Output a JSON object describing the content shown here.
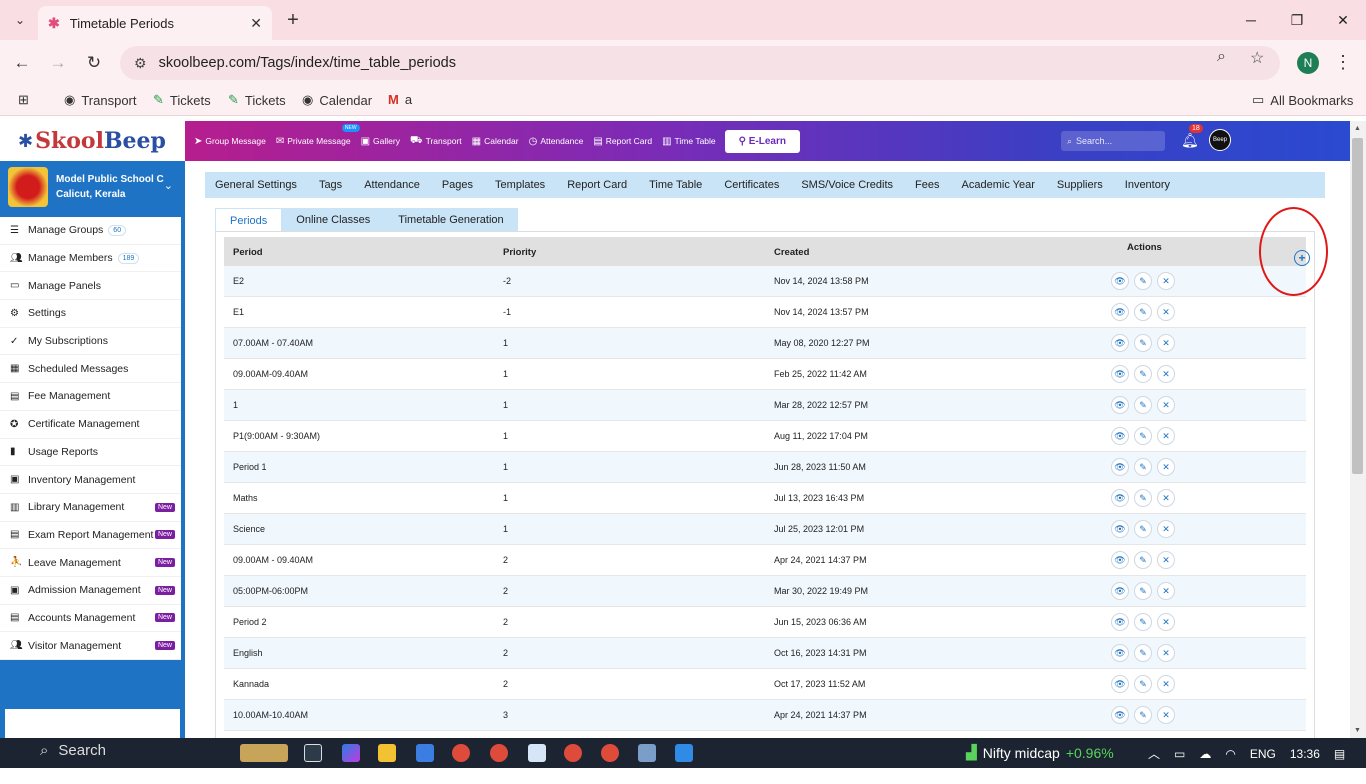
{
  "browser": {
    "tab_title": "Timetable Periods",
    "url": "skoolbeep.com/Tags/index/time_table_periods",
    "bookmarks": [
      "Transport",
      "Tickets",
      "Tickets",
      "Calendar",
      "a"
    ],
    "all_bookmarks": "All Bookmarks",
    "profile_initial": "N"
  },
  "app": {
    "logo_part1": "Skool",
    "logo_part2": "Beep",
    "topnav": [
      {
        "label": "Group Message",
        "icon": "send-icon"
      },
      {
        "label": "Private Message",
        "icon": "mail-icon",
        "badge": "NEW"
      },
      {
        "label": "Gallery",
        "icon": "image-icon"
      },
      {
        "label": "Transport",
        "icon": "bus-icon"
      },
      {
        "label": "Calendar",
        "icon": "calendar-icon"
      },
      {
        "label": "Attendance",
        "icon": "clock-icon"
      },
      {
        "label": "Report Card",
        "icon": "document-icon"
      },
      {
        "label": "Time Table",
        "icon": "timetable-icon"
      }
    ],
    "elearn": "E-Learn",
    "search_placeholder": "Search...",
    "notification_count": "18",
    "avatar_text": "Beep"
  },
  "school": {
    "name": "Model Public School C",
    "location": "Calicut, Kerala"
  },
  "sidebar": [
    {
      "label": "Manage Groups",
      "count": "60",
      "icon": "list-icon"
    },
    {
      "label": "Manage Members",
      "count": "189",
      "icon": "users-icon"
    },
    {
      "label": "Manage Panels",
      "icon": "monitor-icon"
    },
    {
      "label": "Settings",
      "icon": "gear-icon"
    },
    {
      "label": "My Subscriptions",
      "icon": "check-icon"
    },
    {
      "label": "Scheduled Messages",
      "icon": "calendar-icon"
    },
    {
      "label": "Fee Management",
      "icon": "file-icon"
    },
    {
      "label": "Certificate Management",
      "icon": "certificate-icon"
    },
    {
      "label": "Usage Reports",
      "icon": "chart-icon"
    },
    {
      "label": "Inventory Management",
      "icon": "box-icon"
    },
    {
      "label": "Library Management",
      "icon": "book-icon",
      "new": "New"
    },
    {
      "label": "Exam Report Management",
      "icon": "file-icon",
      "new": "New"
    },
    {
      "label": "Leave Management",
      "icon": "leave-icon",
      "new": "New"
    },
    {
      "label": "Admission Management",
      "icon": "admission-icon",
      "new": "New"
    },
    {
      "label": "Accounts Management",
      "icon": "file-icon",
      "new": "New"
    },
    {
      "label": "Visitor Management",
      "icon": "users-icon",
      "new": "New"
    }
  ],
  "subtabs": [
    "General Settings",
    "Tags",
    "Attendance",
    "Pages",
    "Templates",
    "Report Card",
    "Time Table",
    "Certificates",
    "SMS/Voice Credits",
    "Fees",
    "Academic Year",
    "Suppliers",
    "Inventory"
  ],
  "innertabs": [
    "Periods",
    "Online Classes",
    "Timetable Generation"
  ],
  "table": {
    "headers": [
      "Period",
      "Priority",
      "Created",
      "Actions"
    ],
    "rows": [
      [
        "E2",
        "-2",
        "Nov 14, 2024 13:58 PM"
      ],
      [
        "E1",
        "-1",
        "Nov 14, 2024 13:57 PM"
      ],
      [
        "07.00AM - 07.40AM",
        "1",
        "May 08, 2020 12:27 PM"
      ],
      [
        "09.00AM-09.40AM",
        "1",
        "Feb 25, 2022 11:42 AM"
      ],
      [
        "1",
        "1",
        "Mar 28, 2022 12:57 PM"
      ],
      [
        "P1(9:00AM - 9:30AM)",
        "1",
        "Aug 11, 2022 17:04 PM"
      ],
      [
        "Period 1",
        "1",
        "Jun 28, 2023 11:50 AM"
      ],
      [
        "Maths",
        "1",
        "Jul 13, 2023 16:43 PM"
      ],
      [
        "Science",
        "1",
        "Jul 25, 2023 12:01 PM"
      ],
      [
        "09.00AM - 09.40AM",
        "2",
        "Apr 24, 2021 14:37 PM"
      ],
      [
        "05:00PM-06:00PM",
        "2",
        "Mar 30, 2022 19:49 PM"
      ],
      [
        "Period 2",
        "2",
        "Jun 15, 2023 06:36 AM"
      ],
      [
        "English",
        "2",
        "Oct 16, 2023 14:31 PM"
      ],
      [
        "Kannada",
        "2",
        "Oct 17, 2023 11:52 AM"
      ],
      [
        "10.00AM-10.40AM",
        "3",
        "Apr 24, 2021 14:37 PM"
      ]
    ]
  },
  "taskbar": {
    "search": "Search",
    "nifty_label": "Nifty midcap",
    "nifty_change": "+0.96%",
    "lang": "ENG",
    "time": "13:36"
  },
  "colors": {
    "accent": "#1e73c4",
    "nav_start": "#b61e8e",
    "nav_end": "#2a4ad0",
    "new_badge": "#7b1fa2",
    "highlight": "#e01818"
  }
}
